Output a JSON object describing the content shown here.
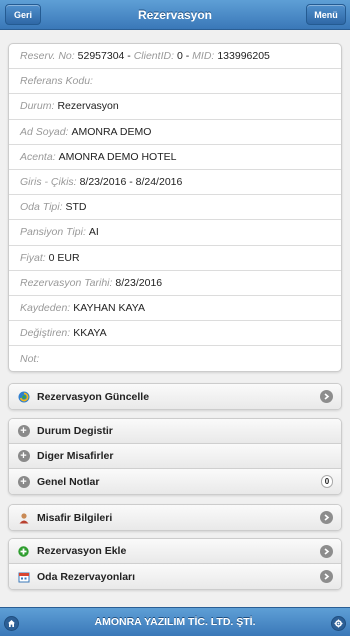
{
  "header": {
    "title": "Rezervasyon",
    "back_label": "Geri",
    "menu_label": "Menü"
  },
  "info": [
    {
      "label": "Reserv. No:",
      "value": "52957304"
    },
    {
      "label": "Referans Kodu:",
      "value": ""
    },
    {
      "label": "Durum:",
      "value": "Rezervasyon"
    },
    {
      "label": "Ad Soyad:",
      "value": "AMONRA DEMO"
    },
    {
      "label": "Acenta:",
      "value": "AMONRA DEMO HOTEL"
    },
    {
      "label": "Giris - Çikis:",
      "value": "8/23/2016 - 8/24/2016"
    },
    {
      "label": "Oda Tipi:",
      "value": "STD"
    },
    {
      "label": "Pansiyon Tipi:",
      "value": "AI"
    },
    {
      "label": "Fiyat:",
      "value": "0 EUR"
    },
    {
      "label": "Rezervasyon Tarihi:",
      "value": "8/23/2016"
    },
    {
      "label": "Kaydeden:",
      "value": "KAYHAN KAYA"
    },
    {
      "label": "Değiştiren:",
      "value": "KKAYA"
    },
    {
      "label": "Not:",
      "value": ""
    }
  ],
  "reserv_extra": {
    "sep": " - ",
    "client_label": "ClientID:",
    "client_value": "0",
    "mid_label": "MID:",
    "mid_value": "133996205"
  },
  "actions": {
    "update": "Rezervasyon Güncelle",
    "status": "Durum Degistir",
    "guests": "Diger Misafirler",
    "notes": "Genel Notlar",
    "notes_count": "0",
    "guest_info": "Misafir Bilgileri",
    "add": "Rezervasyon Ekle",
    "room_res": "Oda Rezervayonları"
  },
  "footer": {
    "title": "AMONRA YAZILIM TİC. LTD. ŞTİ."
  },
  "icons": {
    "home": "home-icon",
    "settings": "gear-icon",
    "refresh": "refresh-icon",
    "plus": "plus-circle-icon",
    "person": "person-icon",
    "add": "add-icon",
    "calendar": "calendar-icon",
    "arrow": "chevron-right-icon"
  },
  "colors": {
    "header": "#3a78b8",
    "add_green": "#2f9e2f"
  }
}
